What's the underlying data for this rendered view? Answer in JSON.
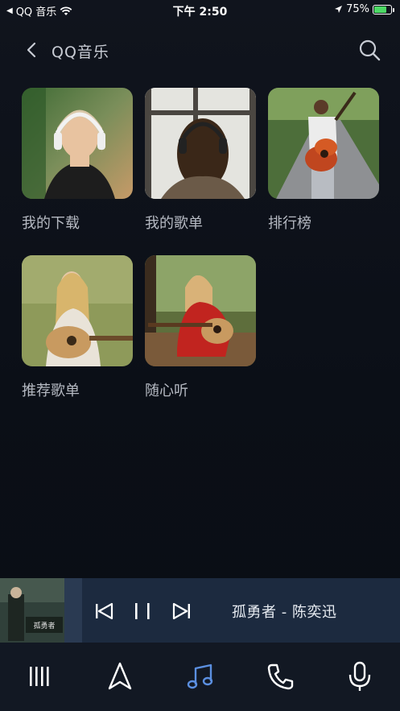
{
  "status_bar": {
    "carrier": "QQ 音乐",
    "time": "下午 2:50",
    "battery": "75%",
    "battery_level": 0.75
  },
  "header": {
    "title": "QQ音乐"
  },
  "grid": [
    {
      "label": "我的下载",
      "image": "woman-headphones-photo"
    },
    {
      "label": "我的歌单",
      "image": "window-headphones-photo"
    },
    {
      "label": "排行榜",
      "image": "guitar-road-photo"
    },
    {
      "label": "推荐歌单",
      "image": "woman-guitar-field-photo"
    },
    {
      "label": "随心听",
      "image": "woman-guitar-park-photo"
    }
  ],
  "player": {
    "track": "孤勇者 - 陈奕迅",
    "art_text": "孤勇者"
  },
  "nav": [
    "menu-icon",
    "navigation-icon",
    "music-icon",
    "phone-icon",
    "mic-icon"
  ],
  "colors": {
    "accent": "#5b8fe0",
    "player_bg": "#1c2a3f",
    "label": "#b5b9c2"
  }
}
